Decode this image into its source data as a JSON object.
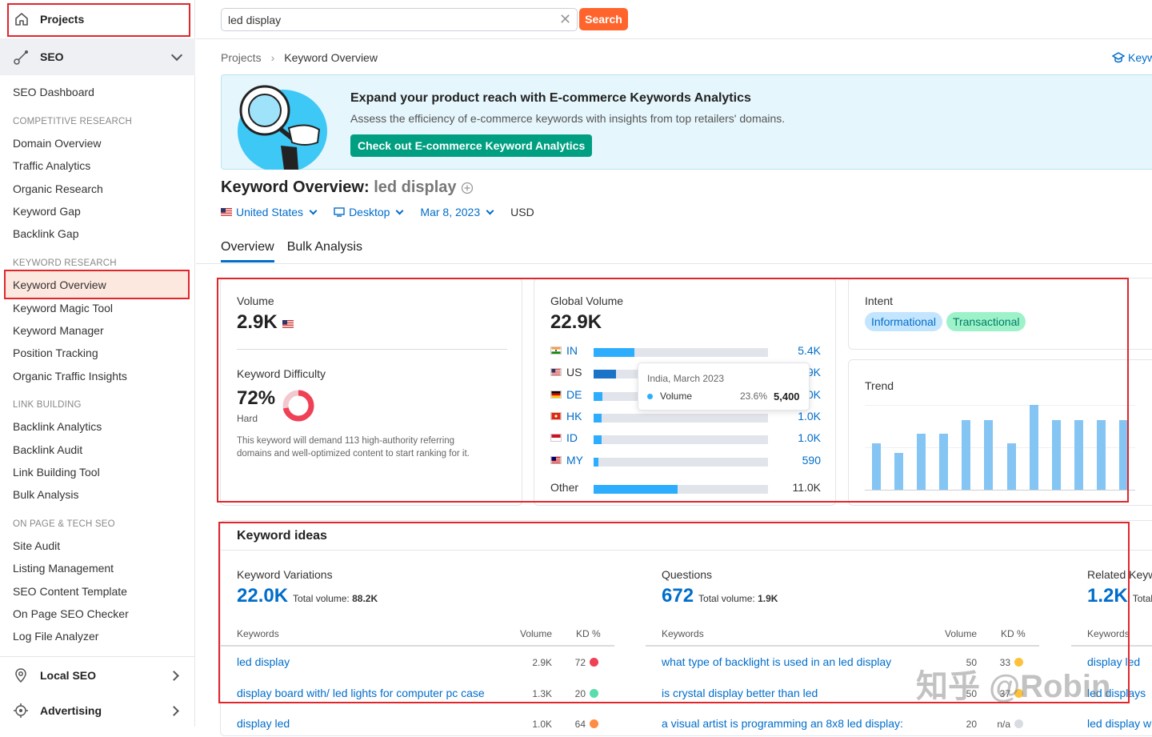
{
  "sidebar": {
    "projects_label": "Projects",
    "seo_label": "SEO",
    "dashboard_label": "SEO Dashboard",
    "sections": [
      {
        "heading": "COMPETITIVE RESEARCH",
        "items": [
          "Domain Overview",
          "Traffic Analytics",
          "Organic Research",
          "Keyword Gap",
          "Backlink Gap"
        ]
      },
      {
        "heading": "KEYWORD RESEARCH",
        "items": [
          "Keyword Overview",
          "Keyword Magic Tool",
          "Keyword Manager",
          "Position Tracking",
          "Organic Traffic Insights"
        ]
      },
      {
        "heading": "LINK BUILDING",
        "items": [
          "Backlink Analytics",
          "Backlink Audit",
          "Link Building Tool",
          "Bulk Analysis"
        ]
      },
      {
        "heading": "ON PAGE & TECH SEO",
        "items": [
          "Site Audit",
          "Listing Management",
          "SEO Content Template",
          "On Page SEO Checker",
          "Log File Analyzer"
        ]
      }
    ],
    "local_seo_label": "Local SEO",
    "advertising_label": "Advertising"
  },
  "search": {
    "value": "led display",
    "button_label": "Search"
  },
  "breadcrumb": {
    "root": "Projects",
    "current": "Keyword Overview"
  },
  "top_right_link": "Keyw",
  "banner": {
    "title": "Expand your product reach with E-commerce Keywords Analytics",
    "subtitle": "Assess the efficiency of e-commerce keywords with insights from top retailers' domains.",
    "button_label": "Check out E-commerce Keyword Analytics"
  },
  "header": {
    "title_prefix": "Keyword Overview:",
    "query": "led display",
    "country": "United States",
    "device": "Desktop",
    "date": "Mar 8, 2023",
    "currency": "USD"
  },
  "tabs": [
    "Overview",
    "Bulk Analysis"
  ],
  "volume_card": {
    "volume_label": "Volume",
    "volume_value": "2.9K",
    "kd_label": "Keyword Difficulty",
    "kd_value": "72%",
    "kd_percent": 72,
    "kd_level": "Hard",
    "kd_desc_line1": "This keyword will demand 113 high-authority referring",
    "kd_desc_line2": "domains and well-optimized content to start ranking for it."
  },
  "global_volume": {
    "label": "Global Volume",
    "value": "22.9K",
    "rows": [
      {
        "code": "IN",
        "value": "5.4K",
        "share": 0.236
      },
      {
        "code": "US",
        "value": "2.9K",
        "share": 0.127
      },
      {
        "code": "DE",
        "value": "1.0K",
        "share": 0.05
      },
      {
        "code": "HK",
        "value": "1.0K",
        "share": 0.045
      },
      {
        "code": "ID",
        "value": "1.0K",
        "share": 0.045
      },
      {
        "code": "MY",
        "value": "590",
        "share": 0.026
      }
    ],
    "other_label": "Other",
    "other_value": "11.0K",
    "other_share": 0.48,
    "tooltip": {
      "title": "India, March 2023",
      "series": "Volume",
      "percent": "23.6%",
      "value": "5,400"
    }
  },
  "intent": {
    "label": "Intent",
    "tags": [
      "Informational",
      "Transactional"
    ]
  },
  "trend": {
    "label": "Trend",
    "values": [
      0.55,
      0.43,
      0.66,
      0.66,
      0.82,
      0.82,
      0.55,
      1.0,
      0.82,
      0.82,
      0.82,
      0.82
    ]
  },
  "keyword_ideas": {
    "title": "Keyword ideas",
    "columns": [
      {
        "heading": "Keyword Variations",
        "count": "22.0K",
        "total_label": "Total volume:",
        "total_value": "88.2K",
        "col_keywords": "Keywords",
        "col_volume": "Volume",
        "col_kd": "KD %",
        "rows": [
          {
            "keyword": "led display",
            "volume": "2.9K",
            "kd": "72"
          },
          {
            "keyword": "display board with/ led lights for computer pc case",
            "volume": "1.3K",
            "kd": "20"
          },
          {
            "keyword": "display led",
            "volume": "1.0K",
            "kd": "64"
          }
        ]
      },
      {
        "heading": "Questions",
        "count": "672",
        "total_label": "Total volume:",
        "total_value": "1.9K",
        "col_keywords": "Keywords",
        "col_volume": "Volume",
        "col_kd": "KD %",
        "rows": [
          {
            "keyword": "what type of backlight is used in an led display",
            "volume": "50",
            "kd": "33"
          },
          {
            "keyword": "is crystal display better than led",
            "volume": "50",
            "kd": "37"
          },
          {
            "keyword": "a visual artist is programming an 8x8 led display:",
            "volume": "20",
            "kd": "n/a"
          }
        ]
      },
      {
        "heading": "Related Keyw",
        "count": "1.2K",
        "total_label": "Total",
        "col_keywords": "Keywords",
        "rows": [
          {
            "keyword": "display led"
          },
          {
            "keyword": "led displays"
          },
          {
            "keyword": "led display w"
          }
        ]
      }
    ]
  },
  "watermark": "知乎 @Robin",
  "colors": {
    "accent": "#006dca",
    "search_btn": "#ff642d",
    "banner_btn": "#009f81",
    "highlight_border": "#e0262b",
    "kd_hard": "#ef4056",
    "kd_easy": "#59ddaa",
    "kd_medium": "#ff8c43",
    "kd_possible": "#fdc23c"
  }
}
